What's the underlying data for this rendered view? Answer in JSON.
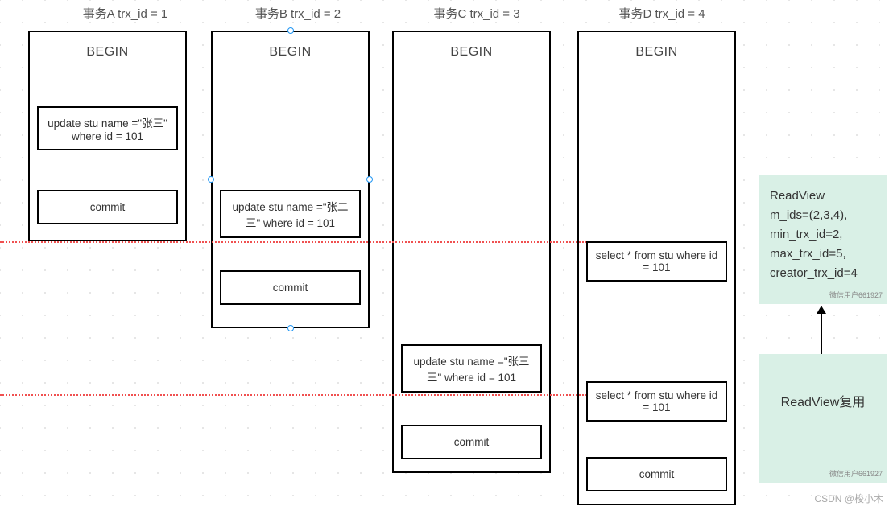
{
  "transactions": {
    "A": {
      "title": "事务A  trx_id = 1",
      "begin": "BEGIN",
      "ops": [
        {
          "text": "update stu name =\"张三\" where id = 101"
        },
        {
          "text": "commit"
        }
      ]
    },
    "B": {
      "title": "事务B  trx_id = 2",
      "begin": "BEGIN",
      "ops": [
        {
          "text": "update stu name =\"张二三\" where id = 101"
        },
        {
          "text": "commit"
        }
      ]
    },
    "C": {
      "title": "事务C  trx_id = 3",
      "begin": "BEGIN",
      "ops": [
        {
          "text": "update stu name =\"张三三\" where id = 101"
        },
        {
          "text": "commit"
        }
      ]
    },
    "D": {
      "title": "事务D  trx_id = 4",
      "begin": "BEGIN",
      "ops": [
        {
          "text": "select * from stu where id = 101"
        },
        {
          "text": "select * from stu where id = 101"
        },
        {
          "text": "commit"
        }
      ]
    }
  },
  "readview1": {
    "l1": "ReadView",
    "l2": "m_ids=(2,3,4),",
    "l3": "min_trx_id=2,",
    "l4": "max_trx_id=5,",
    "l5": "creator_trx_id=4"
  },
  "readview2": {
    "label": "ReadView复用"
  },
  "watermark_small": "微信用户661927",
  "footer": "CSDN @梭小木"
}
